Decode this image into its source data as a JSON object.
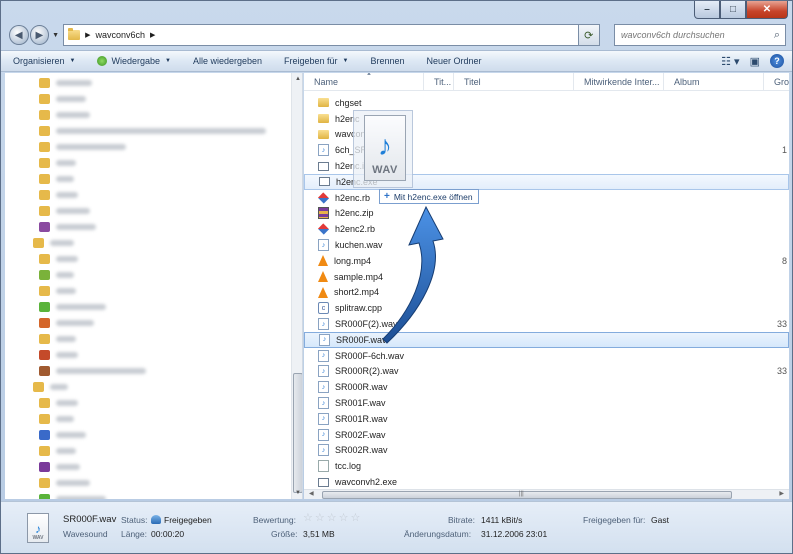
{
  "window": {
    "caption": {
      "minimize": "–",
      "maximize": "□",
      "close": "✕"
    }
  },
  "address": {
    "folder": "wavconv6ch",
    "search_placeholder": "wavconv6ch durchsuchen"
  },
  "toolbar": {
    "organize": "Organisieren",
    "play": "Wiedergabe",
    "play_all": "Alle wiedergeben",
    "share": "Freigeben für",
    "burn": "Brennen",
    "new_folder": "Neuer Ordner"
  },
  "columns": [
    "Name",
    "Tit...",
    "Titel",
    "Mitwirkende Inter...",
    "Album",
    "Gro"
  ],
  "files": [
    {
      "name": "chgset",
      "icon": "folder"
    },
    {
      "name": "h2enc",
      "icon": "folder"
    },
    {
      "name": "wavconvh2",
      "icon": "folder"
    },
    {
      "name": "6ch_SR000F.wav",
      "icon": "wav",
      "extra": "1"
    },
    {
      "name": "h2enc.ico",
      "icon": "exe"
    },
    {
      "name": "h2enc.exe",
      "icon": "exe"
    },
    {
      "name": "h2enc.rb",
      "icon": "rb"
    },
    {
      "name": "h2enc.zip",
      "icon": "zip"
    },
    {
      "name": "h2enc2.rb",
      "icon": "rb"
    },
    {
      "name": "kuchen.wav",
      "icon": "wav"
    },
    {
      "name": "long.mp4",
      "icon": "cone",
      "extra": "8"
    },
    {
      "name": "sample.mp4",
      "icon": "cone"
    },
    {
      "name": "short2.mp4",
      "icon": "cone"
    },
    {
      "name": "splitraw.cpp",
      "icon": "cpp"
    },
    {
      "name": "SR000F(2).wav",
      "icon": "wav",
      "extra": "33"
    },
    {
      "name": "SR000F.wav",
      "icon": "wav"
    },
    {
      "name": "SR000F-6ch.wav",
      "icon": "wav"
    },
    {
      "name": "SR000R(2).wav",
      "icon": "wav",
      "extra": "33"
    },
    {
      "name": "SR000R.wav",
      "icon": "wav"
    },
    {
      "name": "SR001F.wav",
      "icon": "wav"
    },
    {
      "name": "SR001R.wav",
      "icon": "wav"
    },
    {
      "name": "SR002F.wav",
      "icon": "wav"
    },
    {
      "name": "SR002R.wav",
      "icon": "wav"
    },
    {
      "name": "tcc.log",
      "icon": "log"
    },
    {
      "name": "wavconvh2.exe",
      "icon": "exe"
    }
  ],
  "drag": {
    "ghost_label": "WAV",
    "tooltip": "Mit h2enc.exe öffnen"
  },
  "details": {
    "filename": "SR000F.wav",
    "filetype": "Wavesound",
    "icon_label": "WAV",
    "status_label": "Status:",
    "status_value": "Freigegeben",
    "length_label": "Länge:",
    "length_value": "00:00:20",
    "rating_label": "Bewertung:",
    "size_label": "Größe:",
    "size_value": "3,51 MB",
    "bitrate_label": "Bitrate:",
    "bitrate_value": "1411 kBit/s",
    "modified_label": "Änderungsdatum:",
    "modified_value": "31.12.2006 23:01",
    "shared_label": "Freigegeben für:",
    "shared_value": "Gast"
  }
}
